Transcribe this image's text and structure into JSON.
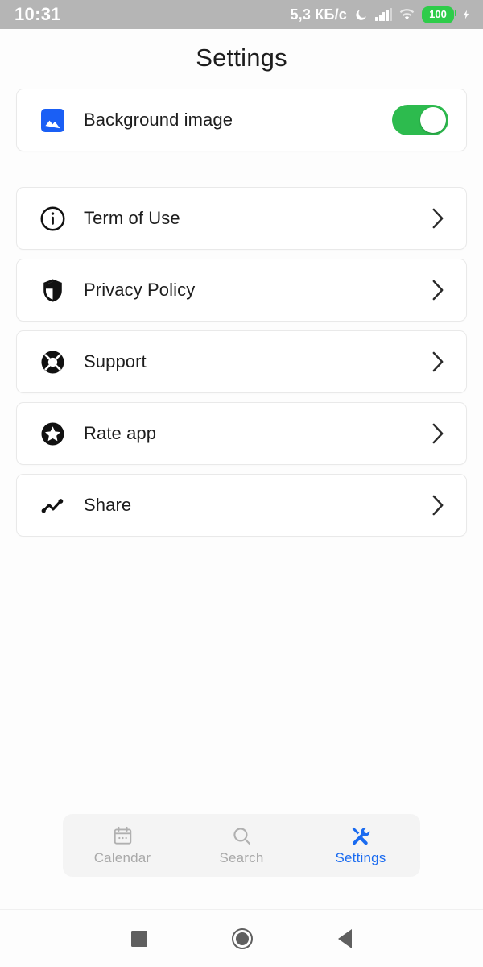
{
  "status_bar": {
    "time": "10:31",
    "network_speed": "5,3 КБ/с",
    "battery_level": "100",
    "icons": [
      "moon-icon",
      "signal-icon",
      "wifi-icon",
      "battery-icon",
      "charging-bolt-icon"
    ]
  },
  "header": {
    "title": "Settings"
  },
  "settings": {
    "toggle_row": {
      "label": "Background image",
      "icon": "image-icon",
      "enabled": true,
      "accent_on": "#2dbb4e",
      "icon_color": "#1a5ff5"
    },
    "rows": [
      {
        "label": "Term of Use",
        "icon": "info-circle-icon"
      },
      {
        "label": "Privacy Policy",
        "icon": "shield-icon"
      },
      {
        "label": "Support",
        "icon": "lifebuoy-icon"
      },
      {
        "label": "Rate app",
        "icon": "star-circle-icon"
      },
      {
        "label": "Share",
        "icon": "share-trend-icon"
      }
    ]
  },
  "tabbar": {
    "active": "Settings",
    "active_color": "#1a6bf0",
    "inactive_color": "#a9a9a9",
    "tabs": [
      {
        "label": "Calendar",
        "icon": "calendar-icon"
      },
      {
        "label": "Search",
        "icon": "search-icon"
      },
      {
        "label": "Settings",
        "icon": "tools-icon"
      }
    ]
  },
  "system_nav": {
    "buttons": [
      "recents-square-icon",
      "home-circle-icon",
      "back-triangle-icon"
    ]
  }
}
